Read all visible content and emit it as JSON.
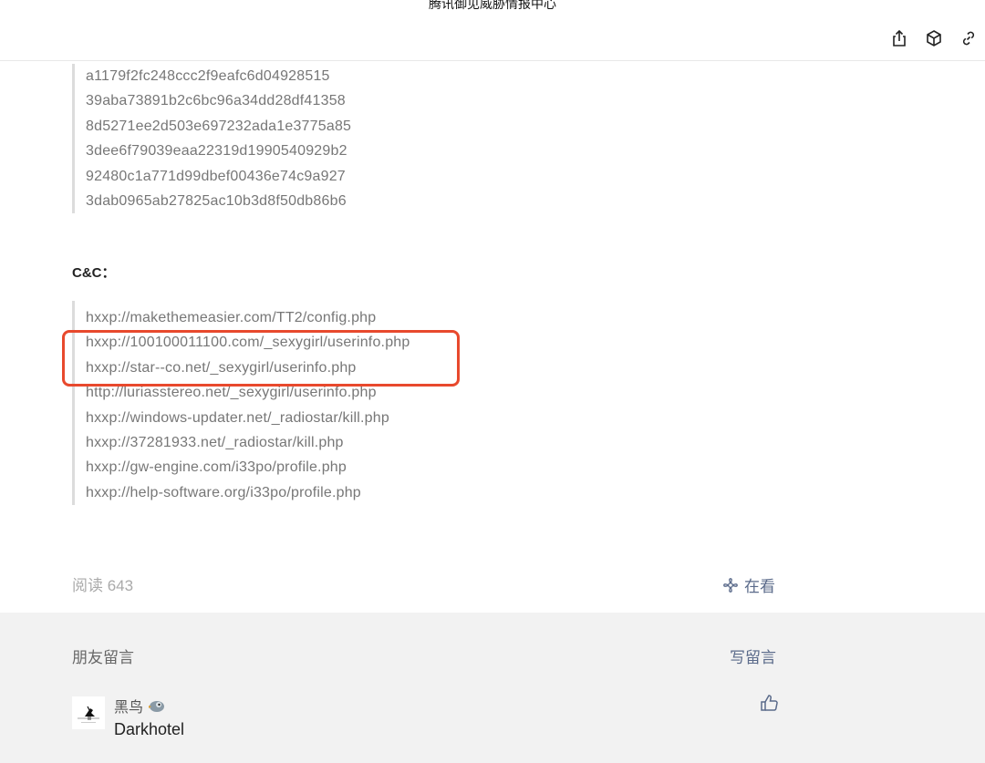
{
  "header": {
    "title": "腾讯御见威胁情报中心",
    "icons": [
      "share-icon",
      "cube-icon",
      "link-icon"
    ]
  },
  "hashes": [
    "a1179f2fc248ccc2f9eafc6d04928515",
    "39aba73891b2c6bc96a34dd28df41358",
    "8d5271ee2d503e697232ada1e3775a85",
    "3dee6f79039eaa22319d1990540929b2",
    "92480c1a771d99dbef00436e74c9a927",
    "3dab0965ab27825ac10b3d8f50db86b6"
  ],
  "cnc_label": "C&C：",
  "urls": [
    "hxxp://makethemeasier.com/TT2/config.php",
    "hxxp://100100011100.com/_sexygirl/userinfo.php",
    "hxxp://star--co.net/_sexygirl/userinfo.php",
    "http://luriasstereo.net/_sexygirl/userinfo.php",
    "hxxp://windows-updater.net/_radiostar/kill.php",
    "hxxp://37281933.net/_radiostar/kill.php",
    "hxxp://gw-engine.com/i33po/profile.php",
    "hxxp://help-software.org/i33po/profile.php"
  ],
  "footer": {
    "read_label": "阅读 643",
    "watching_label": "在看"
  },
  "comments": {
    "title": "朋友留言",
    "write_label": "写留言",
    "items": [
      {
        "author": "黑鸟",
        "text": "Darkhotel"
      }
    ]
  },
  "colors": {
    "highlight": "#e8492d",
    "link": "#5a6a8a"
  }
}
